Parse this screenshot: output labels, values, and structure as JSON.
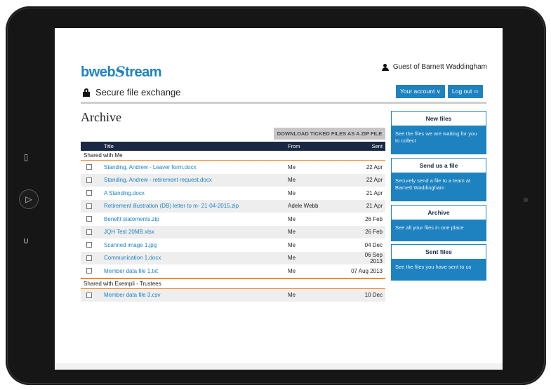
{
  "brand": {
    "logo_part1": "bweb",
    "logo_s": "S",
    "logo_part2": "tream"
  },
  "header": {
    "user_label": "Guest of Barnett Waddingham",
    "secure_title": "Secure file exchange",
    "account_button": "Your account ∨",
    "logout_button": "Log out ⇨"
  },
  "page": {
    "title": "Archive",
    "zip_button": "DOWNLOAD TICKED FILES AS A ZIP FILE"
  },
  "table": {
    "columns": {
      "title": "Title",
      "from": "From",
      "sent": "Sent"
    },
    "groups": [
      {
        "label": "Shared with Me",
        "rows": [
          {
            "title": "Standing, Andrew - Leaver form.docx",
            "from": "Me",
            "sent": "22 Apr"
          },
          {
            "title": "Standing, Andrew - retirement request.docx",
            "from": "Me",
            "sent": "22 Apr"
          },
          {
            "title": "A Standing.docx",
            "from": "Me",
            "sent": "21 Apr"
          },
          {
            "title": "Retirement illustration (DB) letter to m- 21-04-2015.zip",
            "from": "Adele Webb",
            "sent": "21 Apr"
          },
          {
            "title": "Benefit statements.zip",
            "from": "Me",
            "sent": "26 Feb"
          },
          {
            "title": "JQH Test 20MB.xlsx",
            "from": "Me",
            "sent": "26 Feb"
          },
          {
            "title": "Scanned image 1.jpg",
            "from": "Me",
            "sent": "04 Dec"
          },
          {
            "title": "Communication 1.docx",
            "from": "Me",
            "sent": "06 Sep 2013"
          },
          {
            "title": "Member data file 1.txt",
            "from": "Me",
            "sent": "07 Aug 2013"
          }
        ]
      },
      {
        "label": "Shared with Exempli - Trustees",
        "rows": [
          {
            "title": "Member data file 3.csv",
            "from": "Me",
            "sent": "10 Dec"
          }
        ]
      }
    ]
  },
  "sidebar": {
    "panels": [
      {
        "title": "New files",
        "body": "See the files we are waiting for you to collect"
      },
      {
        "title": "Send us a file",
        "body": "Securely send a file to a team at Barnett Waddingham"
      },
      {
        "title": "Archive",
        "body": "See all your files in one place"
      },
      {
        "title": "Sent files",
        "body": "See the files you have sent to us"
      }
    ]
  },
  "colors": {
    "accent": "#1e82c0",
    "header_bg": "#1b2845",
    "group_rule": "#f28a2e"
  }
}
